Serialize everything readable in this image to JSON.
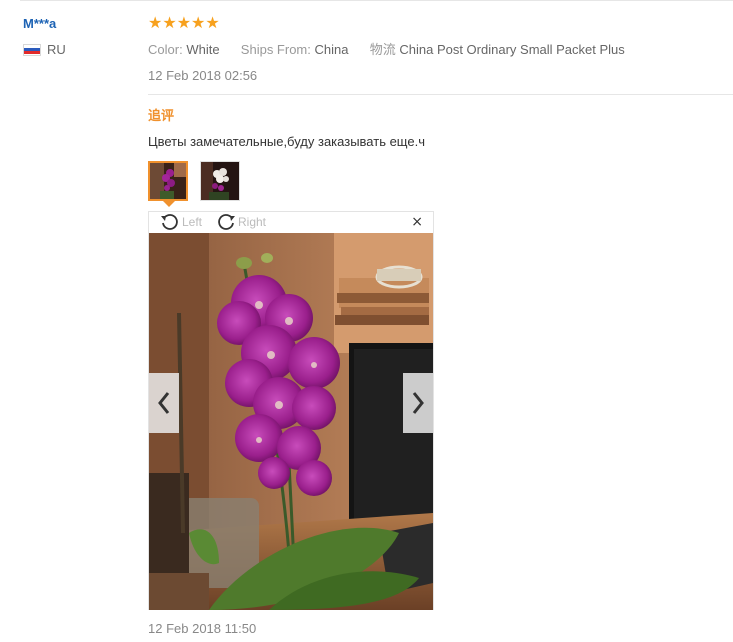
{
  "review": {
    "user_name": "M***a",
    "country_code": "RU",
    "flag_colors": [
      "#ffffff",
      "#2b5bbd",
      "#e22b2b"
    ],
    "rating": 5,
    "stars": [
      "★",
      "★",
      "★",
      "★",
      "★"
    ],
    "properties": [
      {
        "label": "Color:",
        "value": "White"
      },
      {
        "label": "Ships From:",
        "value": "China"
      },
      {
        "label": "物流",
        "value": "China Post Ordinary Small Packet Plus"
      }
    ],
    "date": "12 Feb 2018 02:56"
  },
  "followup": {
    "label": "追评",
    "text": "Цветы замечательные,буду заказывать еще.ч",
    "thumbnails": [
      {
        "name": "photo-1",
        "active": true
      },
      {
        "name": "photo-2",
        "active": false
      }
    ],
    "date": "12 Feb 2018 11:50"
  },
  "viewer": {
    "rotate_left_label": "Left",
    "rotate_right_label": "Right",
    "close_glyph": "×",
    "prev_icon": "chevron-left-icon",
    "next_icon": "chevron-right-icon"
  },
  "colors": {
    "accent": "#f0912d",
    "user_link": "#1d63b4",
    "star": "#f7a11e"
  }
}
